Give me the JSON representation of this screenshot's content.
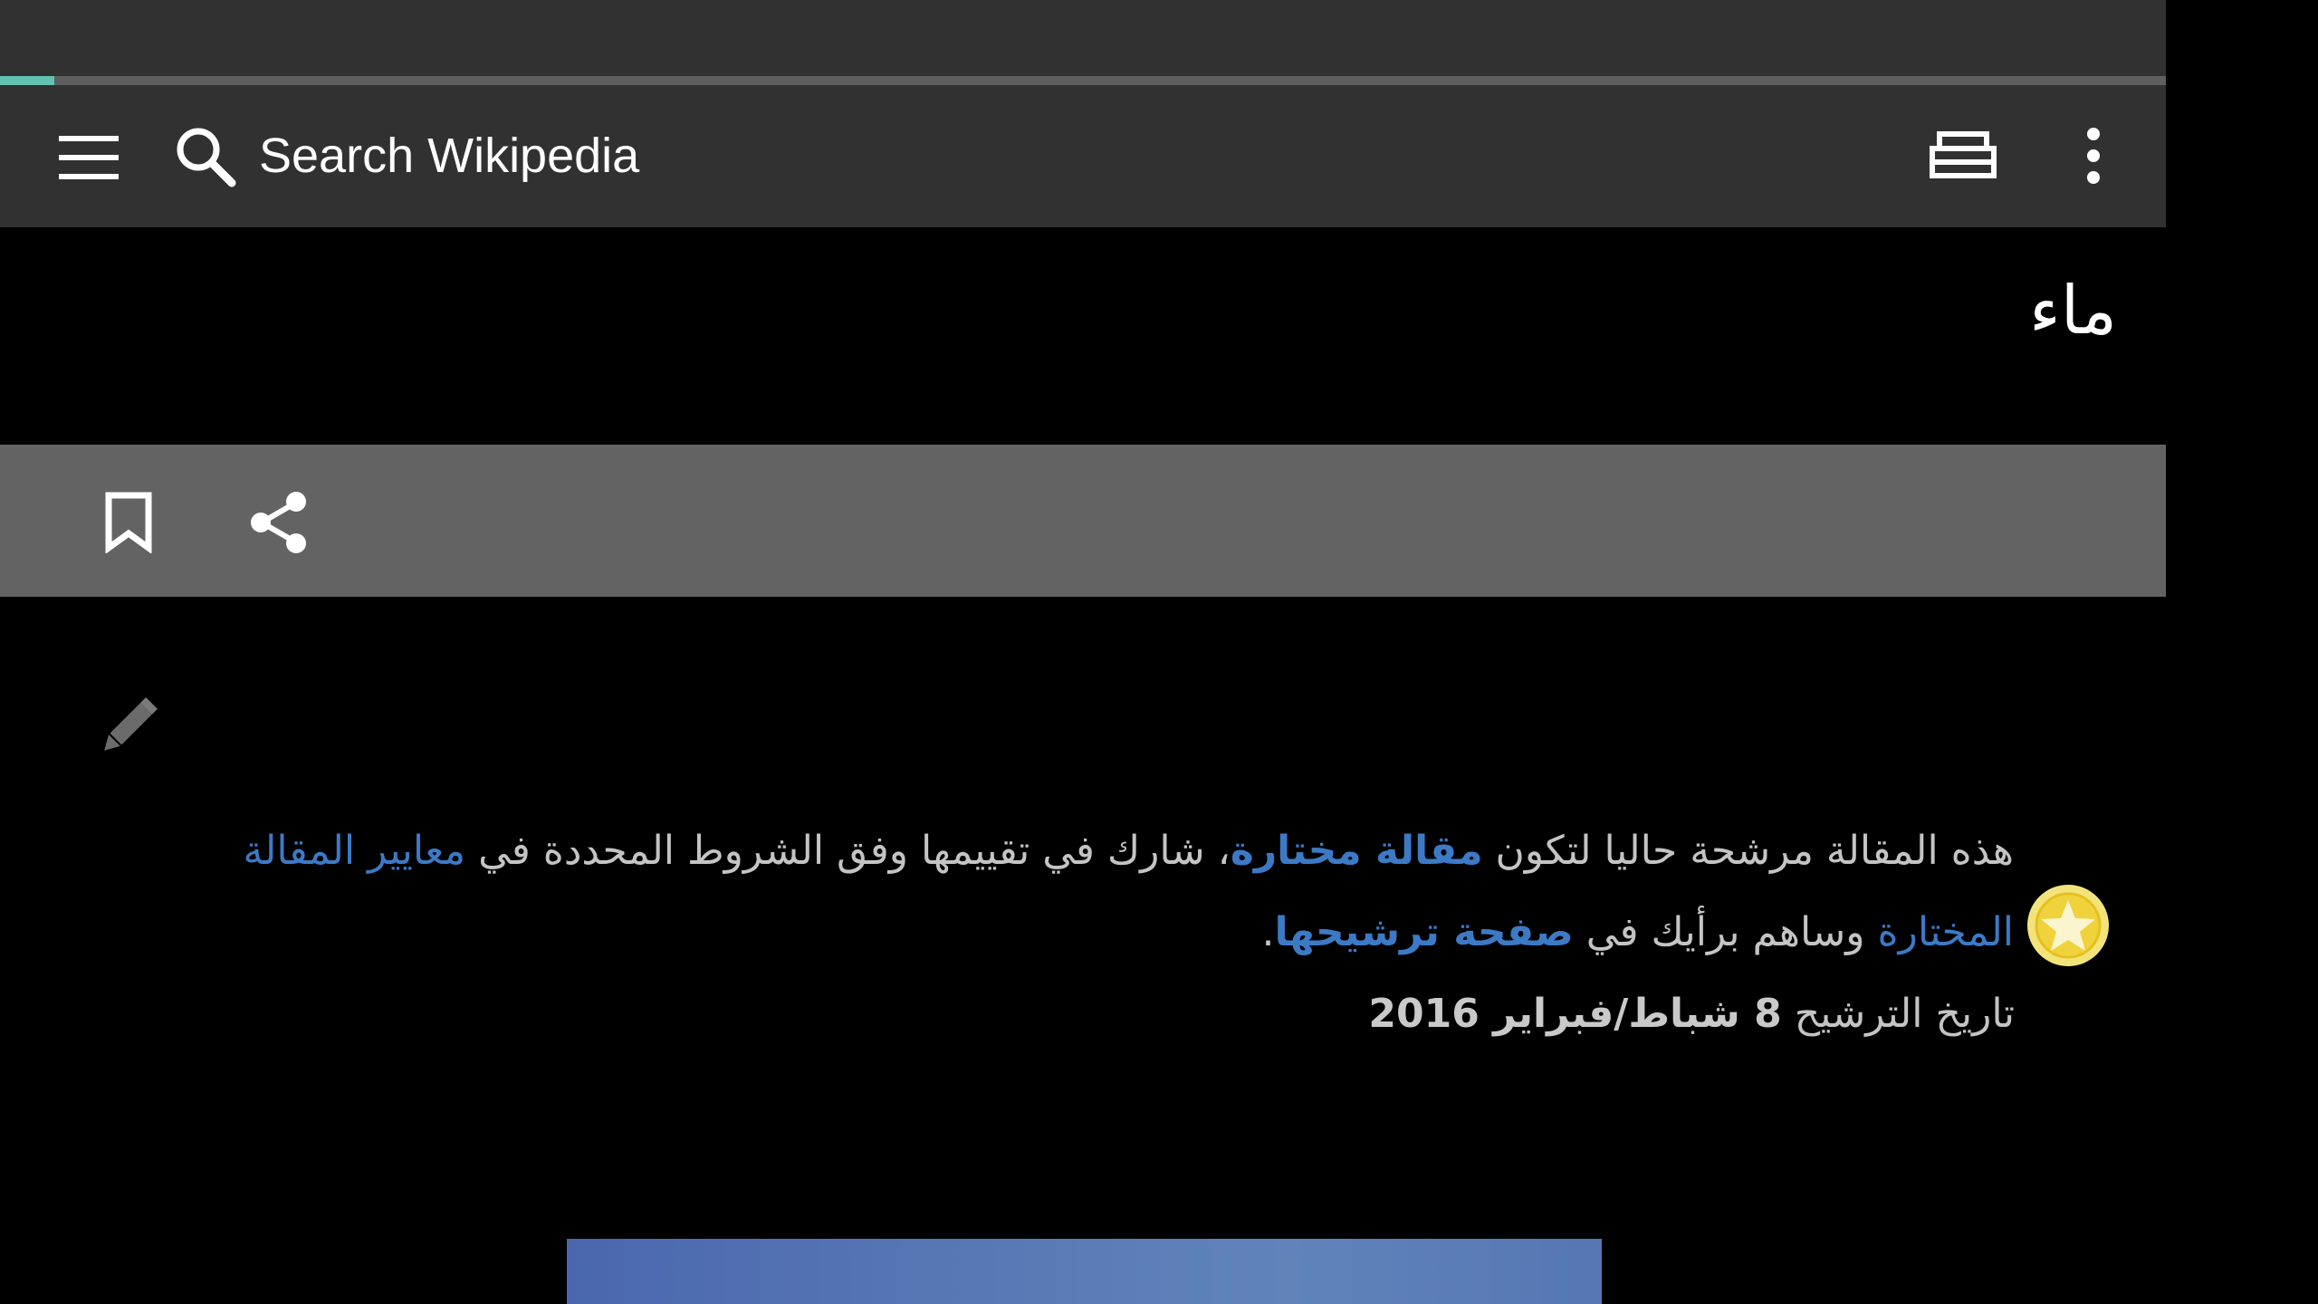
{
  "progress": {
    "value_percent": 2.5,
    "color": "#62c2b1"
  },
  "toolbar": {
    "menu_icon": "hamburger-menu-icon",
    "search_icon": "search-icon",
    "search_placeholder": "Search Wikipedia",
    "tabs_icon": "tabs-icon",
    "overflow_icon": "more-vert-icon"
  },
  "article": {
    "title": "ماء"
  },
  "actions": {
    "bookmark_icon": "bookmark-icon",
    "share_icon": "share-icon",
    "edit_icon": "pencil-icon"
  },
  "notice": {
    "part1": "هذه المقالة مرشحة حاليا لتكون ",
    "link1": "مقالة مختارة",
    "part2": "، شارك في تقييمها وفق الشروط المحددة في ",
    "link2": "معايير المقالة المختارة",
    "part3": " وساهم برأيك في ",
    "link3": "صفحة ترشيحها",
    "part4": ".",
    "date_label": "تاريخ الترشيح ",
    "date_value": "8 شباط/فبراير 2016",
    "icon": "featured-star-icon"
  },
  "colors": {
    "background": "#000000",
    "toolbar": "#313131",
    "action_bar": "#636363",
    "link": "#3c7ac6",
    "text": "#c4c4c4"
  }
}
